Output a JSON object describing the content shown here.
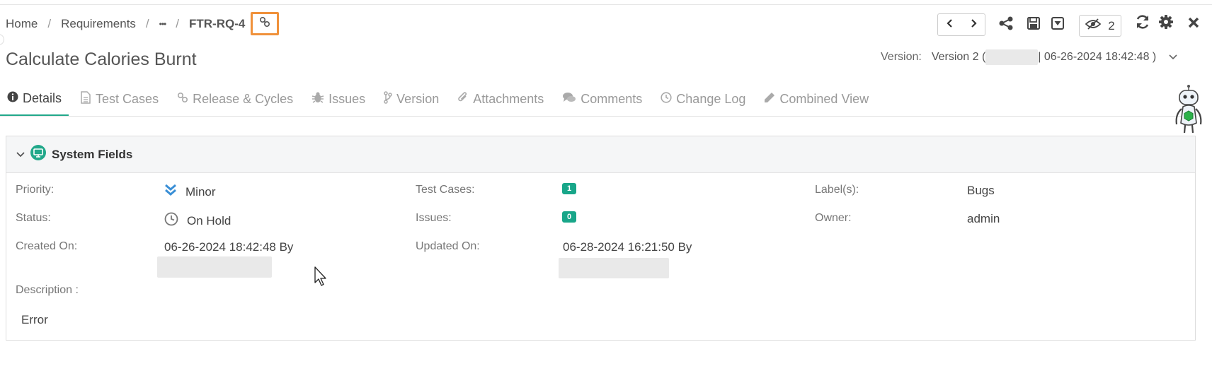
{
  "breadcrumb": {
    "home": "Home",
    "requirements": "Requirements",
    "ellipsis": "•••",
    "current": "FTR-RQ-4",
    "separator": "/"
  },
  "page_title": "Calculate Calories Burnt",
  "toolbar": {
    "prev_icon": "chevron-left-icon",
    "next_icon": "chevron-right-icon",
    "share_icon": "share-icon",
    "save_icon": "save-icon",
    "download_icon": "download-icon",
    "watch_count": "2",
    "refresh_icon": "refresh-icon",
    "settings_icon": "gear-icon",
    "close_icon": "close-icon"
  },
  "version": {
    "label": "Version:",
    "value_prefix": "Version 2 (",
    "value_suffix": "| 06-26-2024 18:42:48 )"
  },
  "tabs": [
    {
      "label": "Details",
      "icon": "info-icon",
      "active": true
    },
    {
      "label": "Test Cases",
      "icon": "document-icon",
      "active": false
    },
    {
      "label": "Release & Cycles",
      "icon": "link-icon",
      "active": false
    },
    {
      "label": "Issues",
      "icon": "bug-icon",
      "active": false
    },
    {
      "label": "Version",
      "icon": "branch-icon",
      "active": false
    },
    {
      "label": "Attachments",
      "icon": "paperclip-icon",
      "active": false
    },
    {
      "label": "Comments",
      "icon": "comments-icon",
      "active": false
    },
    {
      "label": "Change Log",
      "icon": "clock-icon",
      "active": false
    },
    {
      "label": "Combined View",
      "icon": "pencil-icon",
      "active": false
    }
  ],
  "panel": {
    "title": "System Fields",
    "fields": {
      "priority": {
        "label": "Priority:",
        "value": "Minor"
      },
      "status": {
        "label": "Status:",
        "value": "On Hold"
      },
      "created_on": {
        "label": "Created On:",
        "value": "06-26-2024 18:42:48 By"
      },
      "test_cases": {
        "label": "Test Cases:",
        "value": "1"
      },
      "issues": {
        "label": "Issues:",
        "value": "0"
      },
      "updated_on": {
        "label": "Updated On:",
        "value": "06-28-2024 16:21:50 By"
      },
      "labels": {
        "label": "Label(s):",
        "value": "Bugs"
      },
      "owner": {
        "label": "Owner:",
        "value": "admin"
      },
      "description": {
        "label": "Description :",
        "value": "Error"
      }
    }
  },
  "colors": {
    "accent": "#21a88a",
    "highlight": "#f0913a",
    "priority_blue": "#3a8fd6"
  }
}
